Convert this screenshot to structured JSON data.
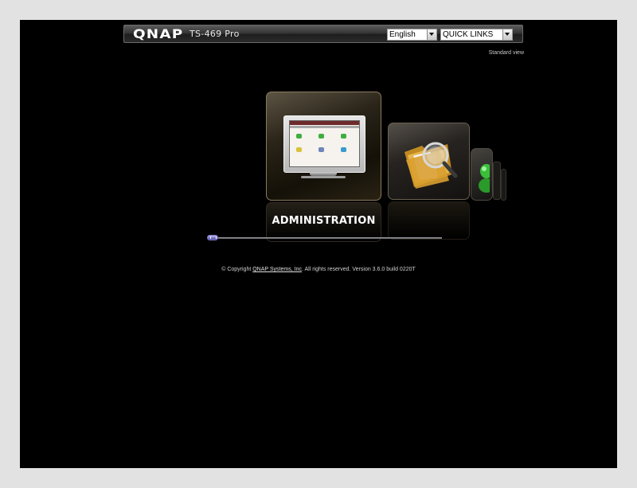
{
  "header": {
    "logo": "QNAP",
    "model": "TS-469 Pro",
    "language": {
      "selected": "English"
    },
    "quick_links": {
      "selected": "QUICK LINKS"
    }
  },
  "standard_view_label": "Standard view",
  "carousel": {
    "current_label": "ADMINISTRATION",
    "items": [
      {
        "icon": "monitor-icon"
      },
      {
        "icon": "file-folder-search-icon"
      },
      {
        "icon": "user-icon"
      }
    ],
    "scroll_position": 0
  },
  "footer": {
    "copyright_prefix": "© Copyright ",
    "company_link": "QNAP Systems, Inc",
    "copyright_suffix": ".  All rights reserved.  Version 3.6.0 build 0220T"
  },
  "colors": {
    "background": "#000000",
    "page_frame": "#e2e2e2",
    "tile_border": "#8a7a5c",
    "scroll_thumb": "#6f6ad1"
  }
}
